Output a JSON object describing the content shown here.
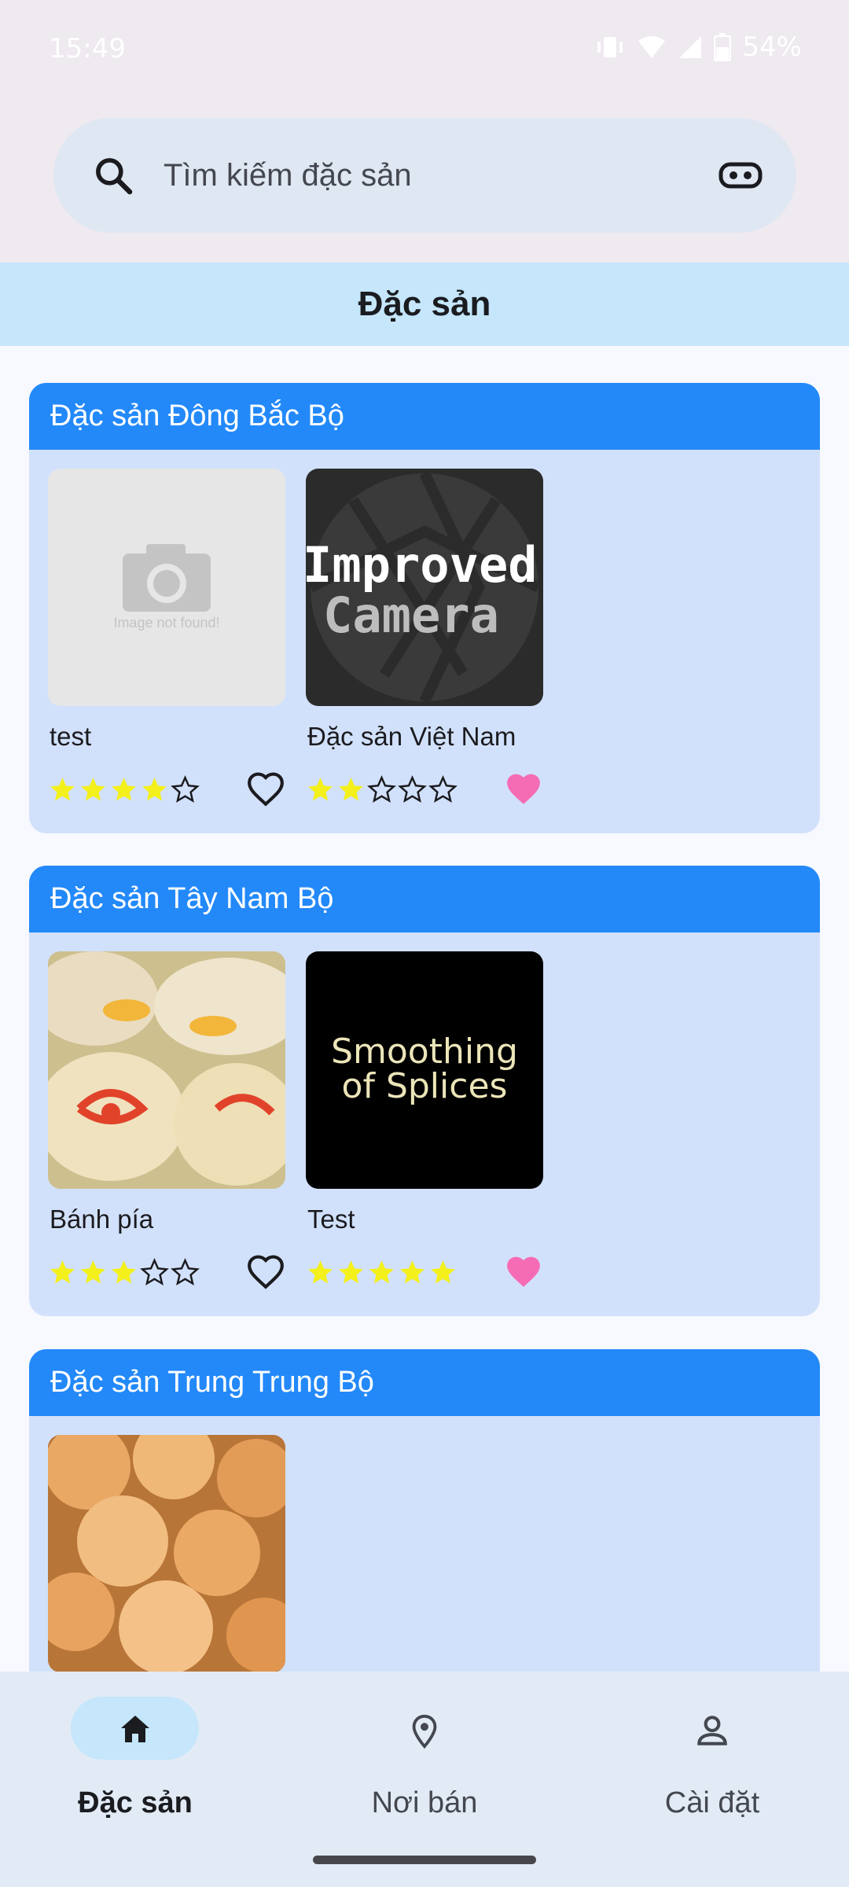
{
  "status_bar": {
    "time": "15:49",
    "battery": "54%"
  },
  "search": {
    "placeholder": "Tìm kiếm đặc sản",
    "leading_icon": "search-icon",
    "trailing_icon": "vr-headset-icon"
  },
  "header": {
    "title": "Đặc sản"
  },
  "colors": {
    "accent": "#2389f9",
    "card_bg": "#d2e1fb",
    "header_bg": "#c5e6fb",
    "star": "#f3f01b",
    "heart": "#f56cb4"
  },
  "regions": [
    {
      "title": "Đặc sản Đông Bắc Bộ",
      "products": [
        {
          "name": "test",
          "rating": 4,
          "favorite": false,
          "image_text": "Image not found!"
        },
        {
          "name": "Đặc sản Việt Nam",
          "rating": 2,
          "favorite": true,
          "image_text_1": "Improved",
          "image_text_2": "Camera"
        }
      ]
    },
    {
      "title": "Đặc sản Tây Nam Bộ",
      "products": [
        {
          "name": "Bánh pía",
          "rating": 3,
          "favorite": false
        },
        {
          "name": "Test",
          "rating": 5,
          "favorite": true,
          "image_text_1": "Smoothing",
          "image_text_2": "of Splices"
        }
      ]
    },
    {
      "title": "Đặc sản Trung Trung Bộ",
      "products": [
        {
          "name": "",
          "rating": 0,
          "favorite": false
        }
      ]
    }
  ],
  "bottom_nav": {
    "items": [
      {
        "label": "Đặc sản",
        "icon": "home-icon",
        "active": true
      },
      {
        "label": "Nơi bán",
        "icon": "location-pin-icon",
        "active": false
      },
      {
        "label": "Cài đặt",
        "icon": "person-icon",
        "active": false
      }
    ]
  }
}
